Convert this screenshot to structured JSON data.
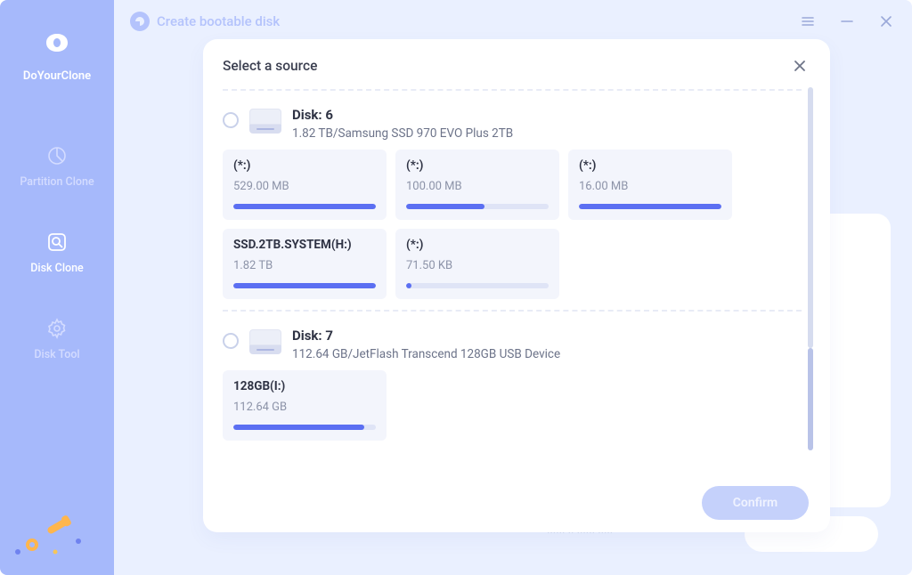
{
  "brand": "DoYourClone",
  "window_title": "Create bootable disk",
  "sidebar": {
    "items": [
      {
        "label": "Partition Clone"
      },
      {
        "label": "Disk Clone"
      },
      {
        "label": "Disk Tool"
      }
    ]
  },
  "modal": {
    "title": "Select a source",
    "confirm_label": "Confirm",
    "disks": [
      {
        "name": "Disk: 6",
        "desc": "1.82 TB/Samsung SSD 970 EVO Plus 2TB",
        "partitions": [
          {
            "label": "(*:)",
            "size": "529.00 MB",
            "fill": 100
          },
          {
            "label": "(*:)",
            "size": "100.00 MB",
            "fill": 55
          },
          {
            "label": "(*:)",
            "size": "16.00 MB",
            "fill": 100
          },
          {
            "label": "SSD.2TB.SYSTEM(H:)",
            "size": "1.82 TB",
            "fill": 100
          },
          {
            "label": "(*:)",
            "size": "71.50 KB",
            "fill": 4
          }
        ]
      },
      {
        "name": "Disk: 7",
        "desc": "112.64 GB/JetFlash Transcend 128GB  USB Device",
        "partitions": [
          {
            "label": "128GB(I:)",
            "size": "112.64 GB",
            "fill": 92
          }
        ]
      }
    ]
  }
}
